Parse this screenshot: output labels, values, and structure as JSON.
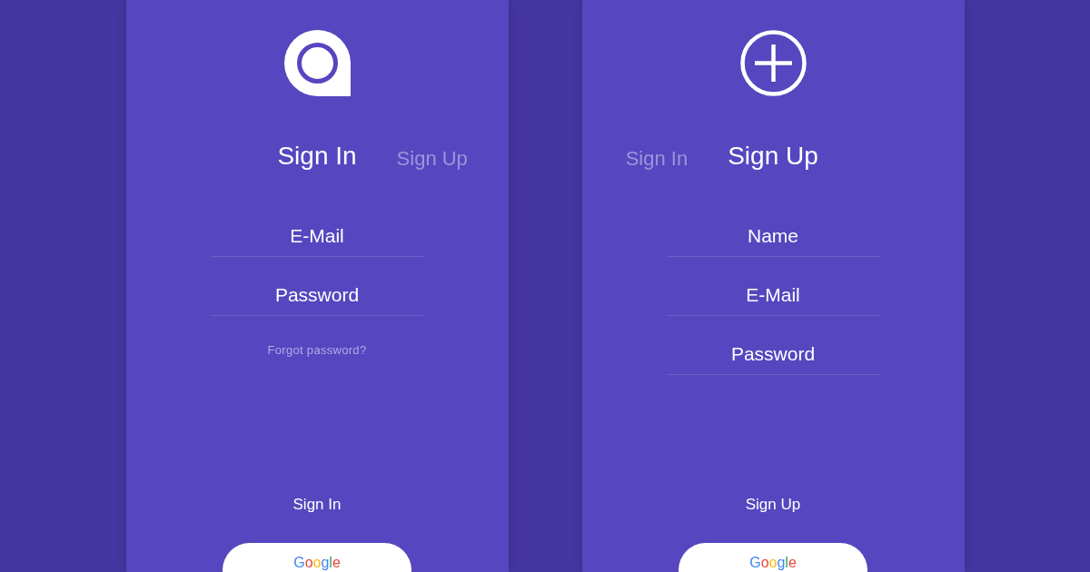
{
  "screens": [
    {
      "kind": "sign_in",
      "tabs": [
        {
          "label": "Sign In",
          "selected": true
        },
        {
          "label": "Sign Up",
          "selected": false
        }
      ],
      "fields": [
        {
          "placeholder": "E-Mail"
        },
        {
          "placeholder": "Password"
        }
      ],
      "forgot_link": "Forgot password?",
      "submit": "Sign In",
      "google_button": "Google"
    },
    {
      "kind": "sign_up",
      "tabs": [
        {
          "label": "Sign In",
          "selected": false
        },
        {
          "label": "Sign Up",
          "selected": true
        }
      ],
      "fields": [
        {
          "placeholder": "Name"
        },
        {
          "placeholder": "E-Mail"
        },
        {
          "placeholder": "Password"
        }
      ],
      "submit": "Sign Up",
      "google_button": "Google"
    }
  ]
}
